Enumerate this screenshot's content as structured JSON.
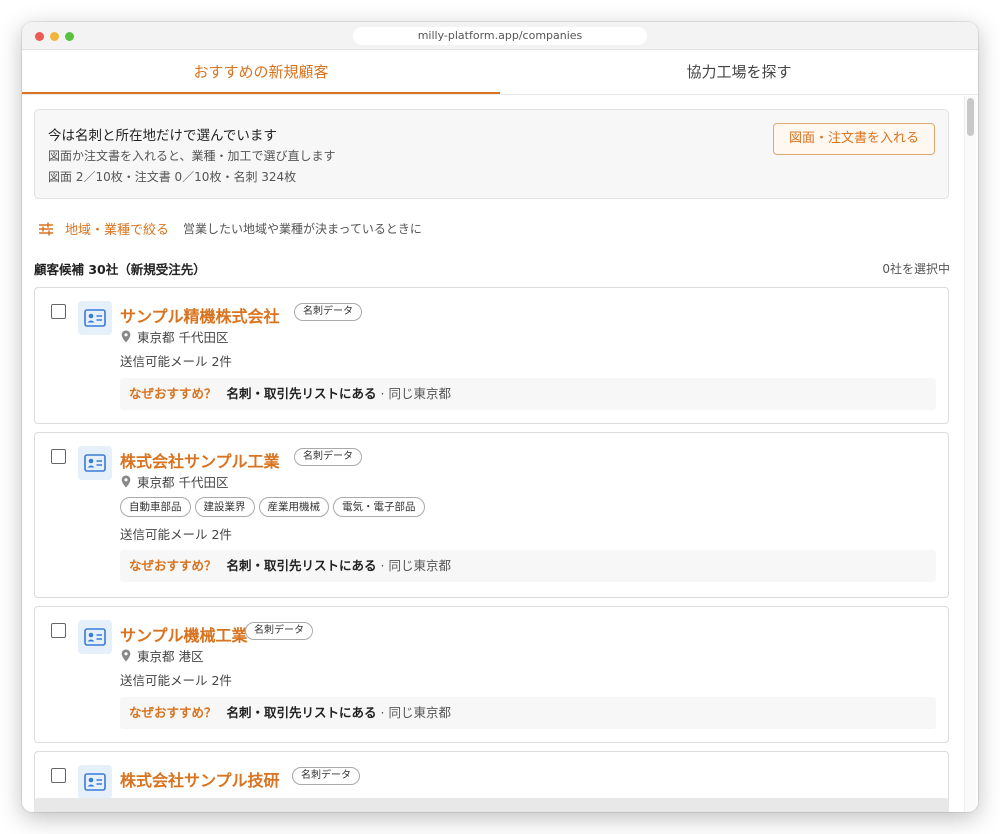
{
  "browser": {
    "url": "milly-platform.app/companies"
  },
  "tabs": [
    {
      "label": "おすすめの新規顧客",
      "active": true
    },
    {
      "label": "協力工場を探す",
      "active": false
    }
  ],
  "notice": {
    "title": "今は名刺と所在地だけで選んでいます",
    "subtitle": "図面か注文書を入れると、業種・加工で選び直します",
    "counts": "図面 2／10枚・注文書 0／10枚・名刺 324枚",
    "button": "図面・注文書を入れる"
  },
  "filter": {
    "label": "地域・業種で絞る",
    "hint": "営業したい地域や業種が決まっているときに"
  },
  "list": {
    "heading": "顧客候補 30社（新規受注先）",
    "selected": "0社を選択中"
  },
  "reason_prefix": "なぜおすすめ？",
  "cards": [
    {
      "name": "サンプル精機株式会社",
      "badge": "名刺データ",
      "location": "東京都 千代田区",
      "tags": [],
      "mail": "送信可能メール 2件",
      "reason_main": "名刺・取引先リストにある",
      "reason_extra": "· 同じ東京都"
    },
    {
      "name": "株式会社サンプル工業",
      "badge": "名刺データ",
      "location": "東京都 千代田区",
      "tags": [
        "自動車部品",
        "建設業界",
        "産業用機械",
        "電気・電子部品"
      ],
      "mail": "送信可能メール 2件",
      "reason_main": "名刺・取引先リストにある",
      "reason_extra": "· 同じ東京都"
    },
    {
      "name": "サンプル機械工業",
      "badge": "名刺データ",
      "location": "東京都 港区",
      "tags": [],
      "mail": "送信可能メール 2件",
      "reason_main": "名刺・取引先リストにある",
      "reason_extra": "· 同じ東京都"
    },
    {
      "name": "株式会社サンプル技研",
      "badge": "名刺データ"
    }
  ],
  "colors": {
    "accent": "#d9731f",
    "icon_bg": "#e6f0fb",
    "icon": "#3a7bd5"
  }
}
